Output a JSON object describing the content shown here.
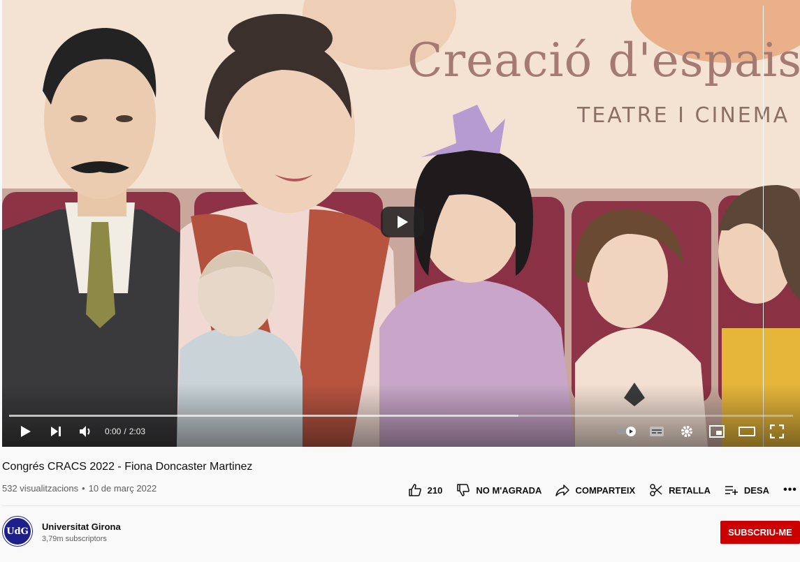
{
  "player": {
    "slide_title": "Creació d'espais",
    "slide_subtitle": "TEATRE I CINEMA",
    "current_time": "0:00",
    "time_separator": "/",
    "duration": "2:03",
    "progress_played": 0,
    "progress_loaded": 0.65,
    "controls": [
      "play-icon",
      "next-icon",
      "volume-icon",
      "autoplay-toggle-icon",
      "subtitles-icon",
      "settings-icon",
      "miniplayer-icon",
      "theater-icon",
      "fullscreen-icon"
    ]
  },
  "video": {
    "title": "Congrés CRACS 2022 - Fiona Doncaster Martinez",
    "views": "532 visualitzacions",
    "date": "10 de març 2022"
  },
  "actions": {
    "like_count": "210",
    "dislike_label": "NO M'AGRADA",
    "share_label": "COMPARTEIX",
    "clip_label": "RETALLA",
    "save_label": "DESA",
    "more_label": "•••"
  },
  "channel": {
    "avatar_text": "UdG",
    "name": "Universitat Girona",
    "subscribers": "3,79m subscriptors",
    "subscribe_label": "SUBSCRIU-ME"
  },
  "colors": {
    "accent_red": "#cc0000",
    "progress_red": "#ff0000",
    "slide_title": "#a47a72",
    "slide_background": "#f4e2d2",
    "avatar_blue": "#1d1f8a"
  }
}
